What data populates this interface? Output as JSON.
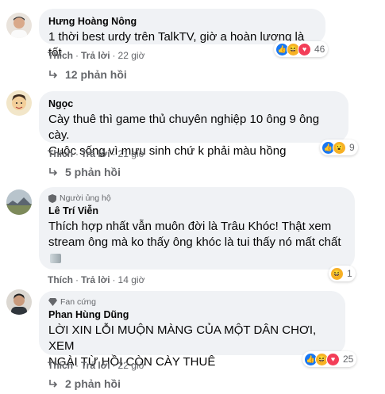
{
  "comments": [
    {
      "author": "Hưng Hoàng Nông",
      "badge": "",
      "text": [
        "1 thời best urdy trên TalkTV, giờ a hoàn lương là tốt"
      ],
      "like_label": "Thích",
      "reply_label": "Trả lời",
      "time": "22 giờ",
      "reactions": [
        "like-icon",
        "haha-icon",
        "love-icon"
      ],
      "reaction_count": "46",
      "replies_label": "12 phản hồi"
    },
    {
      "author": "Ngọc",
      "badge": "",
      "text": [
        "Cày thuê thì game thủ chuyên nghiệp 10 ông 9 ông cày.",
        "Cuộc sống vì mưu sinh chứ k phải màu hồng"
      ],
      "like_label": "Thích",
      "reply_label": "Trả lời",
      "time": "21 giờ",
      "reactions": [
        "like-icon",
        "wow-icon"
      ],
      "reaction_count": "9",
      "replies_label": "5 phản hồi"
    },
    {
      "author": "Lê Trí Viễn",
      "badge": "Người ủng hộ",
      "text": [
        "Thích hợp nhất vẫn muôn đời là Trâu Khóc! Thật xem",
        "stream ông mà ko thấy ông khóc là tui thấy nó mất chất"
      ],
      "like_label": "Thích",
      "reply_label": "Trả lời",
      "time": "14 giờ",
      "reactions": [
        "haha-icon"
      ],
      "reaction_count": "1",
      "replies_label": ""
    },
    {
      "author": "Phan Hùng Dũng",
      "badge": "Fan cứng",
      "text": [
        "LỜI XIN LỖI MUỘN MÀNG CỦA MỘT DÂN CHƠI, XEM",
        "NGÀI TỪ HỒI CÒN CÀY THUÊ"
      ],
      "like_label": "Thích",
      "reply_label": "Trả lời",
      "time": "22 giờ",
      "reactions": [
        "like-icon",
        "haha-icon",
        "love-icon"
      ],
      "reaction_count": "25",
      "replies_label": "2 phản hồi"
    }
  ],
  "colors": {
    "bubble": "#f0f2f5",
    "meta": "#65676b",
    "text": "#050505",
    "like": "#1877f2",
    "love": "#f33e58",
    "haha": "#f7b125"
  }
}
